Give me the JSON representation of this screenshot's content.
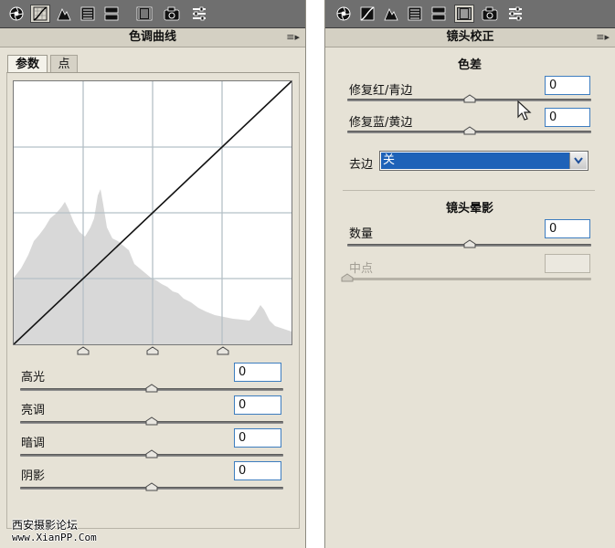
{
  "left_panel": {
    "title": "色调曲线",
    "tabs": [
      {
        "label": "参数",
        "active": true
      },
      {
        "label": "点",
        "active": false
      }
    ],
    "sliders": [
      {
        "label": "高光",
        "value": "0",
        "level": 0.5
      },
      {
        "label": "亮调",
        "value": "0",
        "level": 0.5
      },
      {
        "label": "暗调",
        "value": "0",
        "level": 0.5
      },
      {
        "label": "阴影",
        "value": "0",
        "level": 0.5
      }
    ],
    "split_handles": [
      0.25,
      0.5,
      0.75
    ]
  },
  "right_panel": {
    "title": "镜头校正",
    "chromatic_section": "色差",
    "sliders_chromatic": [
      {
        "label": "修复红/青边",
        "value": "0",
        "level": 0.5
      },
      {
        "label": "修复蓝/黄边",
        "value": "0",
        "level": 0.5
      }
    ],
    "defringe": {
      "label": "去边",
      "value": "关"
    },
    "vignette_section": "镜头晕影",
    "vignette_amount": {
      "label": "数量",
      "value": "0",
      "level": 0.5
    },
    "vignette_midpoint": {
      "label": "中点",
      "value": "",
      "level": 0.0,
      "disabled": true
    }
  },
  "toolbar": {
    "icons": [
      "aperture-icon",
      "curve-icon",
      "detail-icon",
      "hsl-icon",
      "split-toning-icon",
      "lens-icon",
      "camera-icon",
      "presets-icon"
    ]
  },
  "menu_icon": "≡▸",
  "watermark": {
    "line1": "西安摄影论坛",
    "line2": "www.XianPP.Com"
  },
  "colors": {
    "panel_bg": "#e6e2d6",
    "toolbar_bg": "#6f6f6f",
    "select_highlight": "#1e62b8",
    "field_border": "#3d7dbf"
  }
}
